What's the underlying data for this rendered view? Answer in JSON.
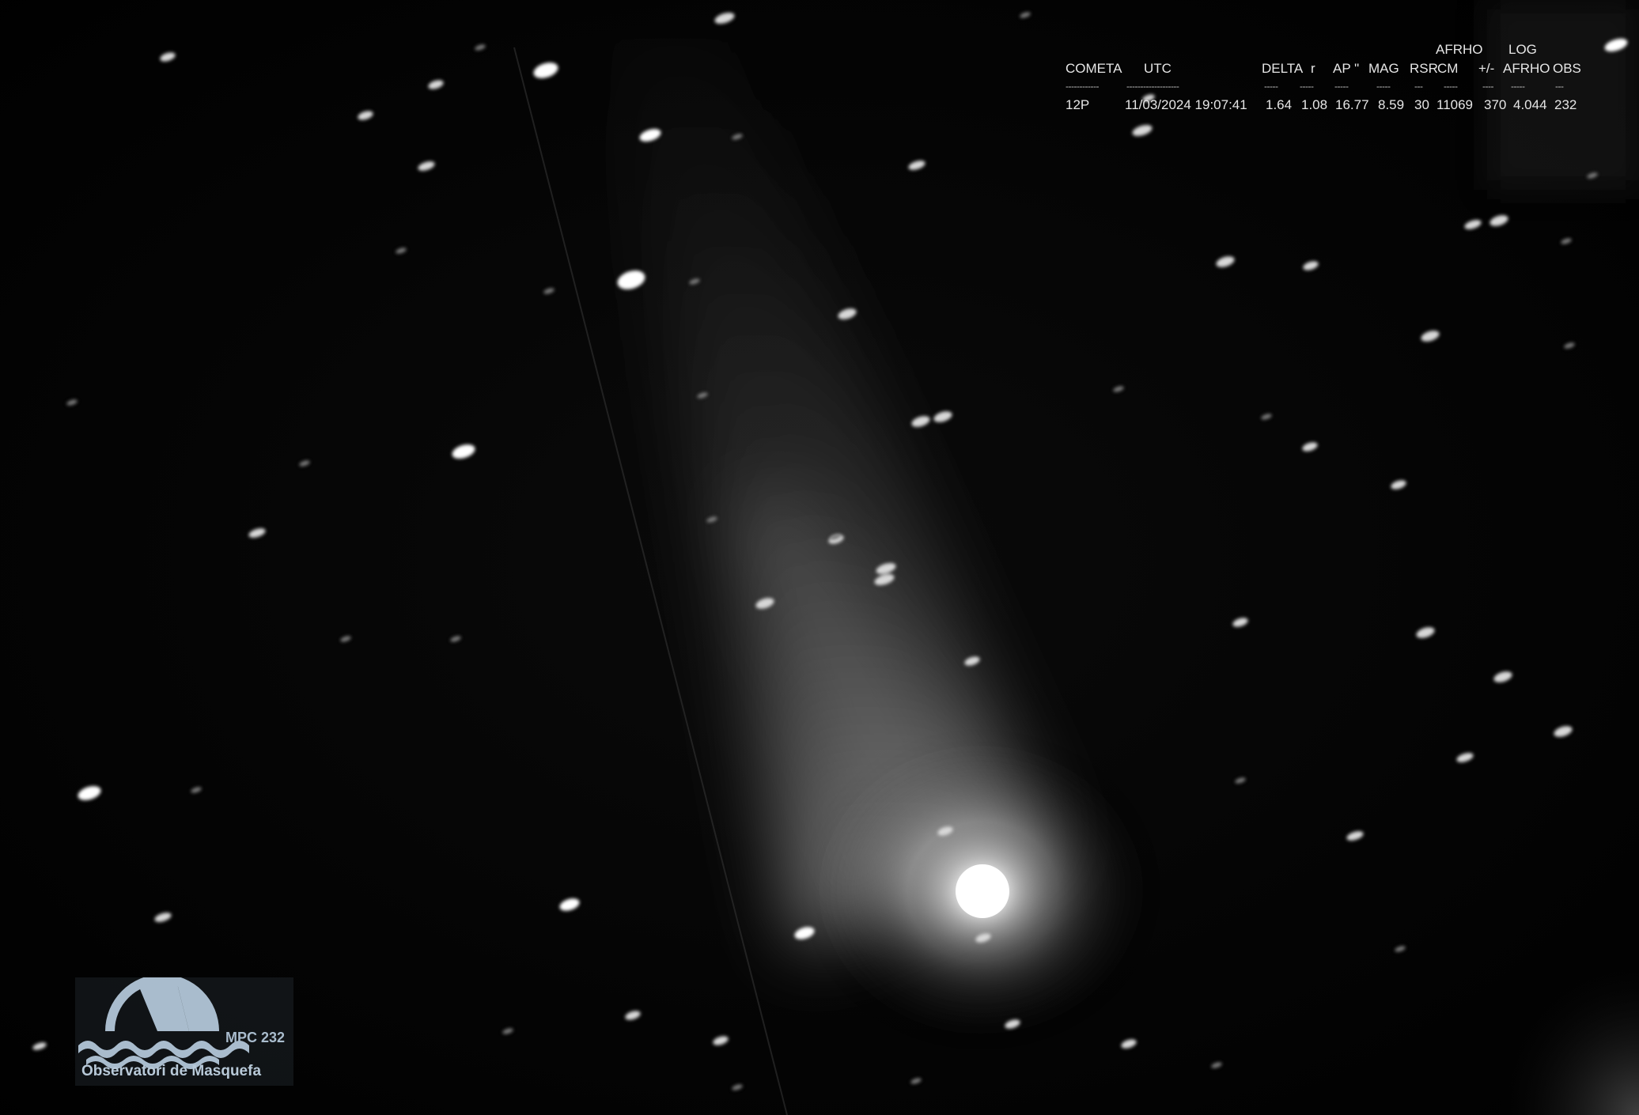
{
  "image": {
    "kind": "astrophotograph",
    "subject_colors": {
      "background": "#000000",
      "coma": "#ffffff",
      "tail": "#8a8a8a"
    }
  },
  "table": {
    "header_top": {
      "afrho": "AFRHO",
      "log": "LOG"
    },
    "headers": [
      "COMETA",
      "UTC",
      "DELTA",
      "r",
      "AP \"",
      "MAG",
      "RSR",
      "CM",
      "+/-",
      "AFRHO",
      "OBS"
    ],
    "dashes": [
      "------------",
      "-------------------",
      "-----",
      "-----",
      "-----",
      "-----",
      "---",
      "-----",
      "----",
      "-----",
      "---"
    ],
    "row": {
      "cometa": "12P",
      "utc": "11/03/2024 19:07:41",
      "delta": "1.64",
      "r": "1.08",
      "ap": "16.77",
      "mag": "8.59",
      "rsr": "30",
      "cm": "11069",
      "pm": "370",
      "logafrho": "4.044",
      "obs": "232"
    }
  },
  "logo": {
    "code": "MPC 232",
    "name": "Observatori de Masquefa",
    "color": "#a9bccd"
  }
}
